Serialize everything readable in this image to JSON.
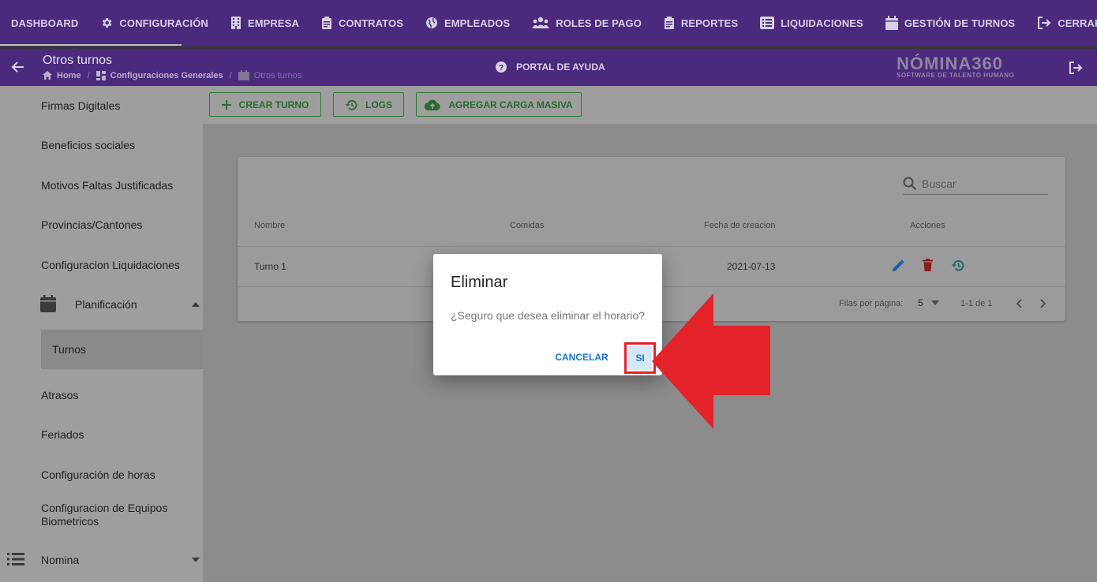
{
  "topnav": {
    "items": [
      {
        "label": "DASHBOARD",
        "icon": "none"
      },
      {
        "label": "CONFIGURACIÓN",
        "icon": "gear-icon"
      },
      {
        "label": "EMPRESA",
        "icon": "building-icon"
      },
      {
        "label": "CONTRATOS",
        "icon": "clipboard-icon"
      },
      {
        "label": "EMPLEADOS",
        "icon": "globe-icon"
      },
      {
        "label": "ROLES DE PAGO",
        "icon": "group-icon"
      },
      {
        "label": "REPORTES",
        "icon": "clipboard-icon"
      },
      {
        "label": "LIQUIDACIONES",
        "icon": "list-icon"
      },
      {
        "label": "GESTIÓN DE TURNOS",
        "icon": "calendar-icon"
      },
      {
        "label": "CERRAR SESIÓN",
        "icon": "logout-icon"
      }
    ]
  },
  "header": {
    "title": "Otros turnos",
    "breadcrumb": {
      "home": "Home",
      "config": "Configuraciones Generales",
      "current": "Otros turnos"
    },
    "help": "PORTAL DE AYUDA",
    "logo_main": "NÓMINA360",
    "logo_sub": "SOFTWARE DE TALENTO HUMANO"
  },
  "sidebar": {
    "items": [
      "Firmas Digitales",
      "Beneficios sociales",
      "Motivos Faltas Justificadas",
      "Provincias/Cantones",
      "Configuracion Liquidaciones"
    ],
    "planificacion": "Planificación",
    "turnos": "Turnos",
    "items_after": [
      "Atrasos",
      "Feriados",
      "Configuración de horas"
    ],
    "equipos_line1": "Configuracion de Equipos",
    "equipos_line2": "Biometricos",
    "nomina": "Nomina"
  },
  "toolbar": {
    "crear": "CREAR TURNO",
    "logs": "LOGS",
    "carga": "AGREGAR CARGA MASIVA"
  },
  "table": {
    "search_placeholder": "Buscar",
    "headers": {
      "nombre": "Nombre",
      "comidas": "Comidas",
      "fecha": "Fecha de creacion",
      "acciones": "Acciones"
    },
    "rows": [
      {
        "nombre": "Turno 1",
        "comidas": "",
        "fecha": "2021-07-13"
      }
    ],
    "footer": {
      "rows_per_page_label": "Filas por página:",
      "rows_per_page": "5",
      "range": "1-1 de 1"
    }
  },
  "dialog": {
    "title": "Eliminar",
    "message": "¿Seguro que desea eliminar el horario?",
    "cancel": "CANCELAR",
    "confirm": "SI"
  },
  "colors": {
    "nav_bg": "#4b2a7e",
    "overlay": "#9e9e9e",
    "accent_blue": "#1976d2",
    "annotation_red": "#e3222a",
    "delete_red": "#b71c1c",
    "green": "#2d7a3a"
  }
}
